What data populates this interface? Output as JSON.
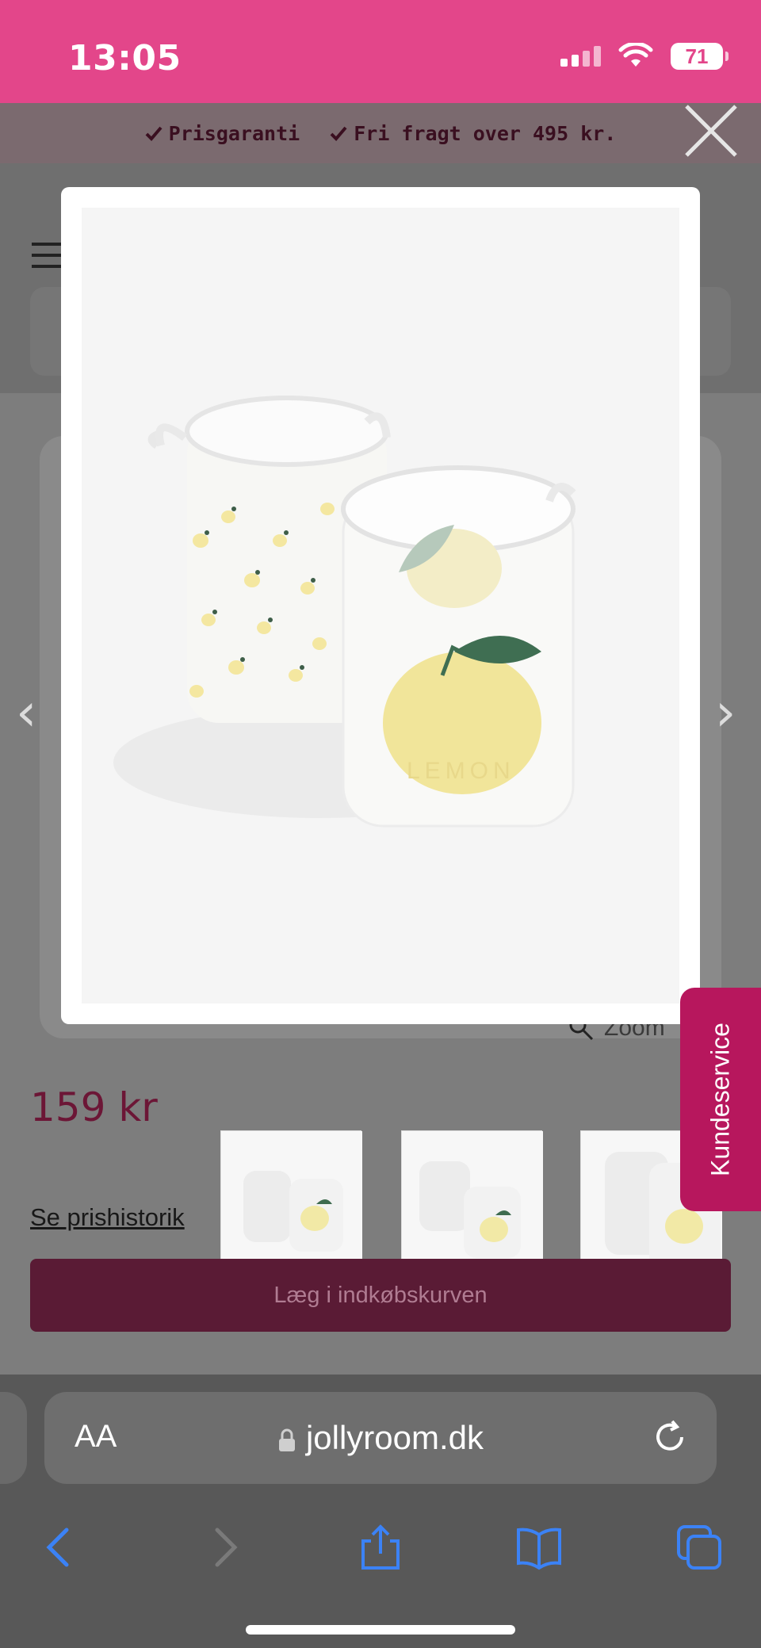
{
  "status_bar": {
    "time": "13:05",
    "battery": "71",
    "icons": [
      "cellular-signal-icon",
      "wifi-icon",
      "battery-icon"
    ]
  },
  "promo_bar": {
    "items": [
      "Prisgaranti",
      "Fri fragt over 495 kr."
    ]
  },
  "product": {
    "price": "159 kr",
    "price_history_link": "Se prishistorik",
    "zoom_label": "Zoom",
    "add_to_cart": "Læg i indkøbskurven"
  },
  "modal": {
    "image_text": "LEMON",
    "close_icon": "close-icon"
  },
  "side_tab": {
    "label": "Kundeservice"
  },
  "browser": {
    "aa_label": "AA",
    "url": "jollyroom.dk",
    "toolbar_icons": [
      "back-icon",
      "forward-icon",
      "share-icon",
      "bookmarks-icon",
      "tabs-icon"
    ]
  },
  "colors": {
    "status_bar": "#e3468a",
    "side_tab": "#b7175d",
    "price": "#6c1636",
    "safari_accent": "#3b82f6"
  }
}
